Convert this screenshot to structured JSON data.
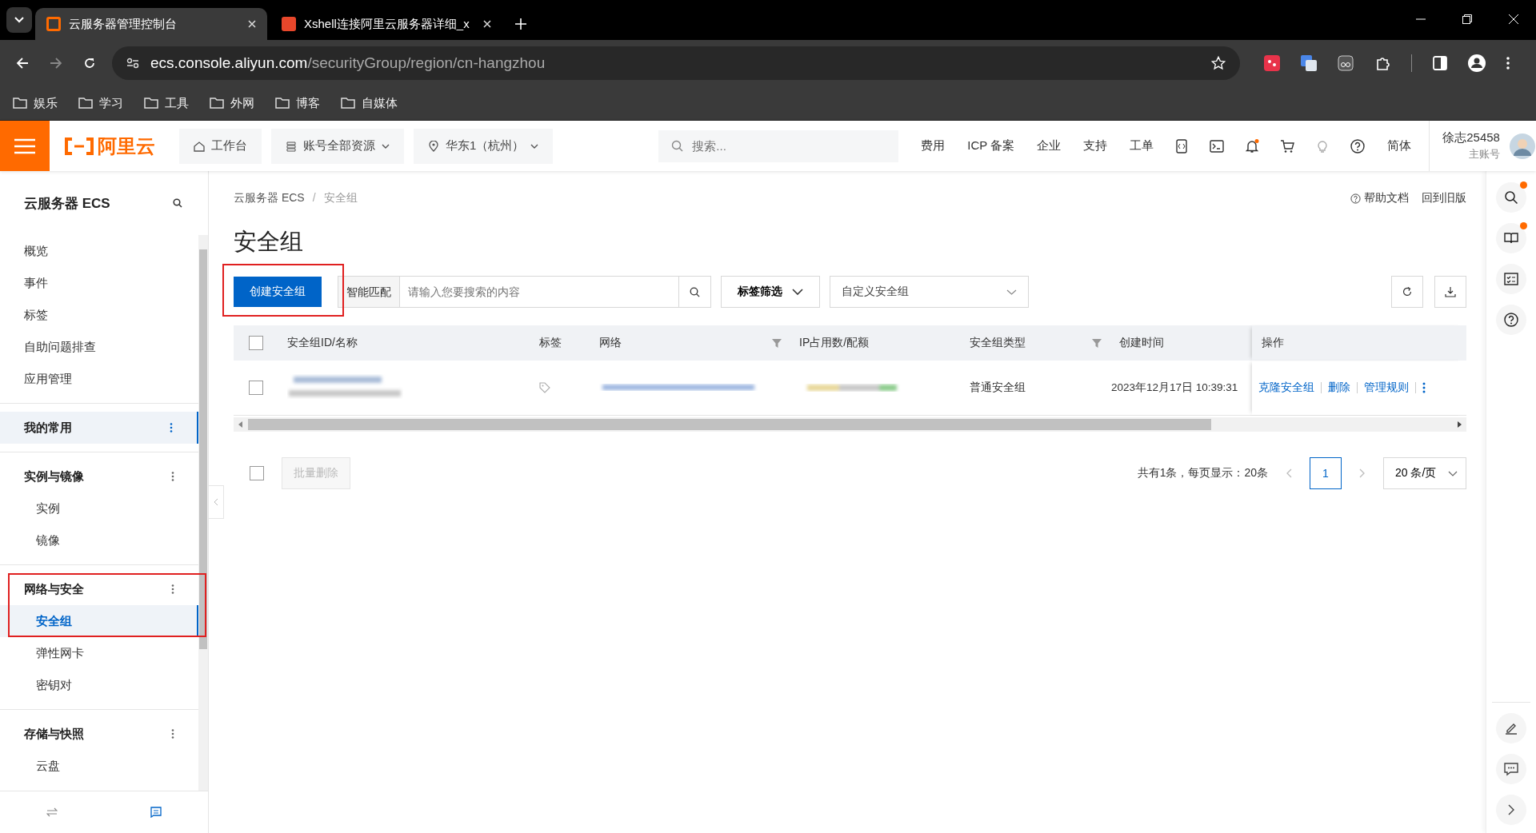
{
  "browser": {
    "tabs": [
      {
        "title": "云服务器管理控制台",
        "selected": true
      },
      {
        "title": "Xshell连接阿里云服务器详细_x",
        "selected": false
      }
    ],
    "address": {
      "host": "ecs.console.aliyun.com",
      "path": "/securityGroup/region/cn-hangzhou"
    },
    "bookmarks": [
      "娱乐",
      "学习",
      "工具",
      "外网",
      "博客",
      "自媒体"
    ]
  },
  "header": {
    "logo": "阿里云",
    "nav_buttons": [
      "工作台",
      "账号全部资源",
      "华东1（杭州）"
    ],
    "search": {
      "placeholder": "搜索..."
    },
    "links": [
      "费用",
      "ICP 备案",
      "企业",
      "支持",
      "工单"
    ],
    "language": "简体",
    "user": {
      "name": "徐志25458",
      "role": "主账号"
    }
  },
  "sidebar": {
    "title": "云服务器 ECS",
    "items": [
      {
        "label": "概览",
        "selected": false
      },
      {
        "label": "事件",
        "selected": false
      },
      {
        "label": "标签",
        "selected": false
      },
      {
        "label": "自助问题排查",
        "selected": false
      },
      {
        "label": "应用管理",
        "selected": false
      }
    ],
    "groups": [
      {
        "label": "我的常用",
        "selected": true
      },
      {
        "label": "实例与镜像",
        "selected": false,
        "items": [
          {
            "label": "实例",
            "selected": false
          },
          {
            "label": "镜像",
            "selected": false
          }
        ]
      },
      {
        "label": "网络与安全",
        "selected": false,
        "highlighted": true,
        "items": [
          {
            "label": "安全组",
            "selected": true
          },
          {
            "label": "弹性网卡",
            "selected": false
          },
          {
            "label": "密钥对",
            "selected": false
          }
        ]
      },
      {
        "label": "存储与快照",
        "selected": false,
        "items": [
          {
            "label": "云盘",
            "selected": false
          }
        ]
      }
    ]
  },
  "breadcrumb": {
    "items": [
      "云服务器 ECS",
      "安全组"
    ],
    "separator": "/"
  },
  "top_links": [
    "帮助文档",
    "回到旧版"
  ],
  "page_title": "安全组",
  "toolbar": {
    "create_button": "创建安全组",
    "create_highlighted": true,
    "match_label": "智能匹配",
    "search_placeholder": "请输入您要搜索的内容",
    "tag_filter": "标签筛选",
    "group_select": "自定义安全组"
  },
  "table": {
    "select_all_checked": false,
    "columns": [
      {
        "label": "安全组ID/名称",
        "kind": "plain"
      },
      {
        "label": "标签",
        "kind": "plain"
      },
      {
        "label": "网络",
        "kind": "filter"
      },
      {
        "label": "IP占用数/配额",
        "kind": "plain"
      },
      {
        "label": "安全组类型",
        "kind": "filter"
      },
      {
        "label": "创建时间",
        "kind": "plain"
      },
      {
        "label": "操作",
        "kind": "plain"
      }
    ],
    "rows": [
      {
        "checked": false,
        "type": "普通安全组",
        "created": "2023年12月17日 10:39:31",
        "actions": [
          "克隆安全组",
          "删除",
          "管理规则"
        ]
      }
    ]
  },
  "footer": {
    "select_all_checked": false,
    "batch_delete": "批量删除",
    "summary": "共有1条，每页显示：20条",
    "pages": [
      {
        "label": "1",
        "selected": true
      }
    ],
    "page_size": "20 条/页"
  }
}
